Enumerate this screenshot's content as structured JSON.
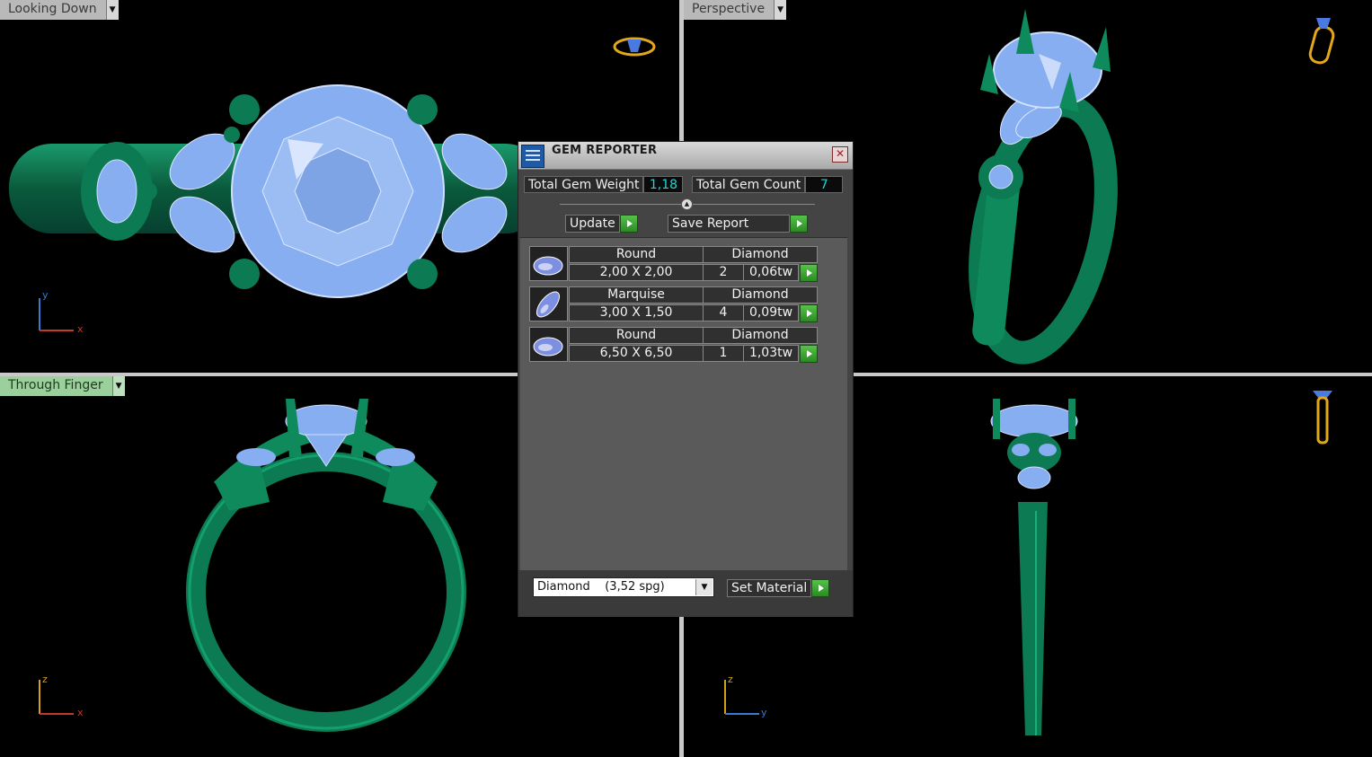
{
  "viewports": {
    "top_left": {
      "label": "Looking Down",
      "axis_v": "y",
      "axis_h": "x"
    },
    "top_right": {
      "label": "Perspective"
    },
    "bottom_left": {
      "label": "Through Finger",
      "axis_v": "z",
      "axis_h": "x"
    },
    "bottom_right": {
      "axis_v": "z",
      "axis_h": "y"
    }
  },
  "gem_reporter": {
    "title": "GEM REPORTER",
    "total_weight_label": "Total Gem Weight",
    "total_weight_value": "1,18",
    "total_count_label": "Total Gem Count",
    "total_count_value": "7",
    "update_label": "Update",
    "save_report_label": "Save Report",
    "gems": [
      {
        "shape": "Round",
        "material": "Diamond",
        "size": "2,00 X 2,00",
        "count": "2",
        "weight": "0,06tw"
      },
      {
        "shape": "Marquise",
        "material": "Diamond",
        "size": "3,00 X 1,50",
        "count": "4",
        "weight": "0,09tw"
      },
      {
        "shape": "Round",
        "material": "Diamond",
        "size": "6,50 X 6,50",
        "count": "1",
        "weight": "1,03tw"
      }
    ],
    "material_select": "Diamond    (3,52 spg)",
    "set_material_label": "Set Material"
  },
  "colors": {
    "metal": "#0e6e4c",
    "gem": "#86aef0",
    "panel": "#444444",
    "accent_green": "#3aa832"
  }
}
